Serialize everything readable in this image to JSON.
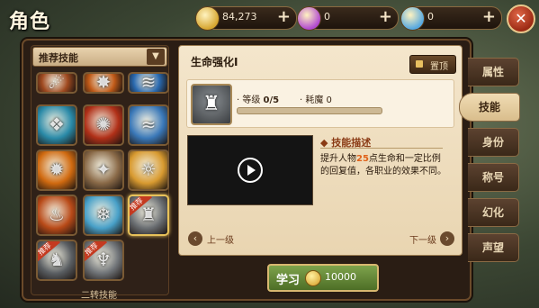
{
  "header": {
    "title": "角色",
    "currencies": [
      {
        "icon": "gold-coin-icon",
        "value": "84,273",
        "color": "#d6a630"
      },
      {
        "icon": "purple-gem-icon",
        "value": "0",
        "color": "#b24ad0"
      },
      {
        "icon": "blue-diamond-icon",
        "value": "0",
        "color": "#56a8e0"
      }
    ],
    "plus": "+",
    "close": "✕"
  },
  "skill_list": {
    "filter": "推荐技能",
    "recommend_tag": "推荐",
    "bottom_label": "二转技能",
    "skills": [
      {
        "name": "meteor-skill-icon",
        "color": "#a04a20",
        "glyph": "☄",
        "partial": true
      },
      {
        "name": "fire-burst-skill-icon",
        "color": "#c05a18",
        "glyph": "✸",
        "partial": true
      },
      {
        "name": "tornado-skill-icon",
        "color": "#2a6ab0",
        "glyph": "≋",
        "partial": true
      },
      {
        "name": "ice-shard-skill-icon",
        "color": "#2a8aa8",
        "glyph": "❖"
      },
      {
        "name": "fireball-skill-icon",
        "color": "#b03018",
        "glyph": "✺"
      },
      {
        "name": "wind-blade-skill-icon",
        "color": "#3a78b8",
        "glyph": "≈"
      },
      {
        "name": "flame-orb-skill-icon",
        "color": "#d06a10",
        "glyph": "✹"
      },
      {
        "name": "rock-smash-skill-icon",
        "color": "#8a6a48",
        "glyph": "✦"
      },
      {
        "name": "light-ward-skill-icon",
        "color": "#d89a30",
        "glyph": "☼"
      },
      {
        "name": "fire-beast-skill-icon",
        "color": "#b84a18",
        "glyph": "♨"
      },
      {
        "name": "crystal-skill-icon",
        "color": "#48a0c8",
        "glyph": "❄"
      },
      {
        "name": "life-strengthen-skill-icon",
        "color": "#6a6e72",
        "glyph": "♜",
        "recommended": true,
        "selected": true
      },
      {
        "name": "shadow-skill-icon",
        "color": "#5a5e62",
        "glyph": "♞",
        "recommended": true
      },
      {
        "name": "claw-skill-icon",
        "color": "#707478",
        "glyph": "♆",
        "recommended": true
      }
    ]
  },
  "detail": {
    "skill_name": "生命强化Ⅰ",
    "top_button": "置顶",
    "level_label": "等级",
    "level_value": "0/5",
    "cost_label": "耗魔",
    "cost_value": "0",
    "level_progress": 0,
    "desc_heading": "技能描述",
    "desc_pre": "提升人物",
    "desc_highlight": "25",
    "desc_post": "点生命和一定比例的回复值，各职业的效果不同。",
    "prev": "上一级",
    "next": "下一级"
  },
  "learn": {
    "label": "学习",
    "cost": "10000"
  },
  "tabs": [
    {
      "label": "属性",
      "active": false
    },
    {
      "label": "技能",
      "active": true
    },
    {
      "label": "身份",
      "active": false
    },
    {
      "label": "称号",
      "active": false
    },
    {
      "label": "幻化",
      "active": false
    },
    {
      "label": "声望",
      "active": false
    }
  ]
}
